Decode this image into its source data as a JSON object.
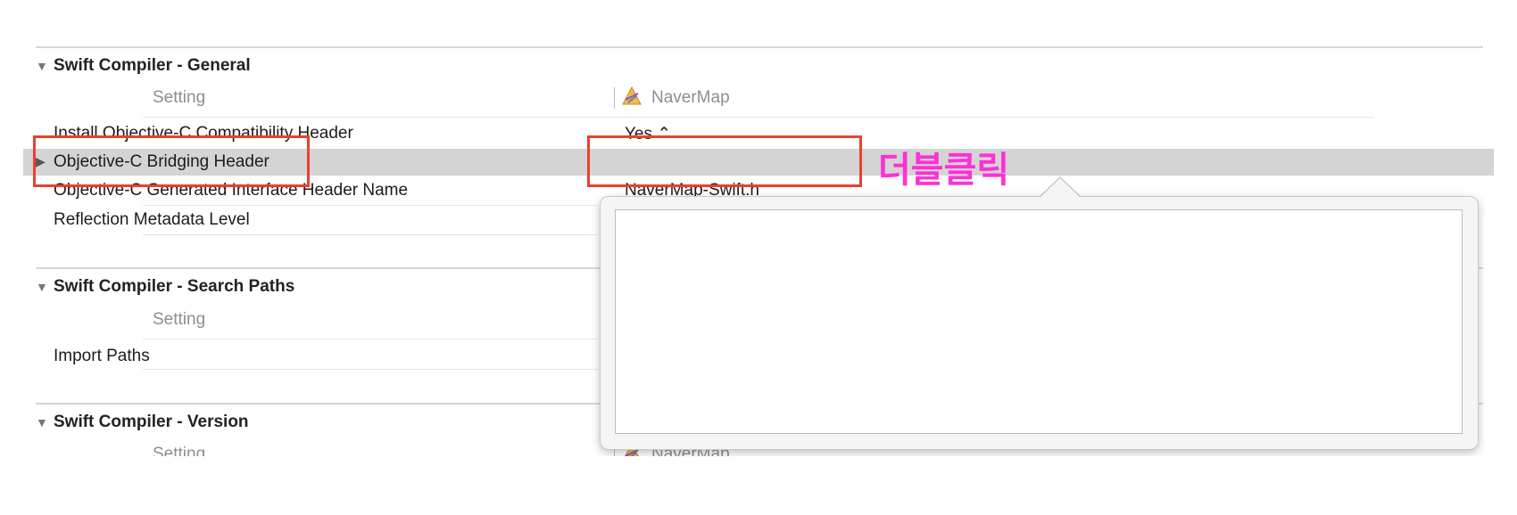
{
  "annotation": {
    "text": "더블클릭",
    "color": "#ff2fd7"
  },
  "highlight_color": "#e8412c",
  "sections": [
    {
      "title": "Swift Compiler - General",
      "setting_header": "Setting",
      "target_name": "NaverMap",
      "rows": [
        {
          "label": "Install Objective-C Compatibility Header",
          "value": "Yes ⌃"
        },
        {
          "label": "Objective-C Bridging Header",
          "value": ""
        },
        {
          "label": "Objective-C Generated Interface Header Name",
          "value": "NaverMap-Swift.h"
        },
        {
          "label": "Reflection Metadata Level",
          "value": ""
        }
      ]
    },
    {
      "title": "Swift Compiler - Search Paths",
      "setting_header": "Setting",
      "rows": [
        {
          "label": "Import Paths",
          "value": ""
        }
      ]
    },
    {
      "title": "Swift Compiler - Version",
      "setting_header": "Setting",
      "target_name": "NaverMap"
    }
  ],
  "popover": {
    "text_value": ""
  }
}
